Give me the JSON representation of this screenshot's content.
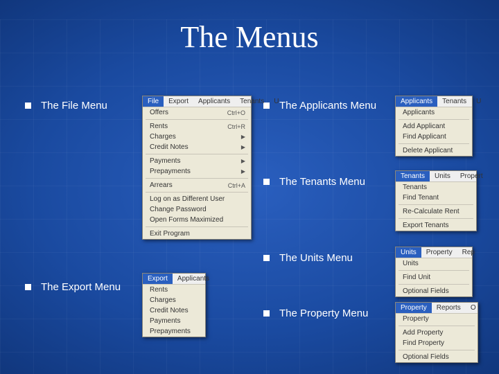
{
  "title": "The Menus",
  "labels": {
    "file": "The File Menu",
    "export": "The Export Menu",
    "applicants": "The Applicants Menu",
    "tenants": "The Tenants Menu",
    "units": "The Units Menu",
    "property": "The Property Menu"
  },
  "menus": {
    "file": {
      "bar": [
        "File",
        "Export",
        "Applicants",
        "Tenants",
        "U"
      ],
      "groups": [
        [
          {
            "t": "Offers",
            "s": "Ctrl+O"
          }
        ],
        [
          {
            "t": "Rents",
            "s": "Ctrl+R"
          },
          {
            "t": "Charges",
            "a": true
          },
          {
            "t": "Credit Notes",
            "a": true
          }
        ],
        [
          {
            "t": "Payments",
            "a": true
          },
          {
            "t": "Prepayments",
            "a": true
          }
        ],
        [
          {
            "t": "Arrears",
            "s": "Ctrl+A"
          }
        ],
        [
          {
            "t": "Log on as Different User"
          },
          {
            "t": "Change Password"
          },
          {
            "t": "Open Forms Maximized"
          }
        ],
        [
          {
            "t": "Exit Program"
          }
        ]
      ]
    },
    "export": {
      "bar": [
        "Export",
        "Applicants"
      ],
      "groups": [
        [
          {
            "t": "Rents"
          },
          {
            "t": "Charges"
          },
          {
            "t": "Credit Notes"
          },
          {
            "t": "Payments"
          },
          {
            "t": "Prepayments"
          }
        ]
      ]
    },
    "applicants": {
      "bar": [
        "Applicants",
        "Tenants",
        "U"
      ],
      "groups": [
        [
          {
            "t": "Applicants"
          }
        ],
        [
          {
            "t": "Add Applicant"
          },
          {
            "t": "Find Applicant"
          }
        ],
        [
          {
            "t": "Delete Applicant"
          }
        ]
      ]
    },
    "tenants": {
      "bar": [
        "Tenants",
        "Units",
        "Propert"
      ],
      "groups": [
        [
          {
            "t": "Tenants"
          },
          {
            "t": "Find Tenant"
          }
        ],
        [
          {
            "t": "Re-Calculate Rent"
          }
        ],
        [
          {
            "t": "Export Tenants"
          }
        ]
      ]
    },
    "units": {
      "bar": [
        "Units",
        "Property",
        "Rep"
      ],
      "groups": [
        [
          {
            "t": "Units"
          }
        ],
        [
          {
            "t": "Find Unit"
          }
        ],
        [
          {
            "t": "Optional Fields"
          }
        ]
      ]
    },
    "property": {
      "bar": [
        "Property",
        "Reports",
        "O"
      ],
      "groups": [
        [
          {
            "t": "Property"
          }
        ],
        [
          {
            "t": "Add Property"
          },
          {
            "t": "Find Property"
          }
        ],
        [
          {
            "t": "Optional Fields"
          }
        ]
      ]
    }
  }
}
